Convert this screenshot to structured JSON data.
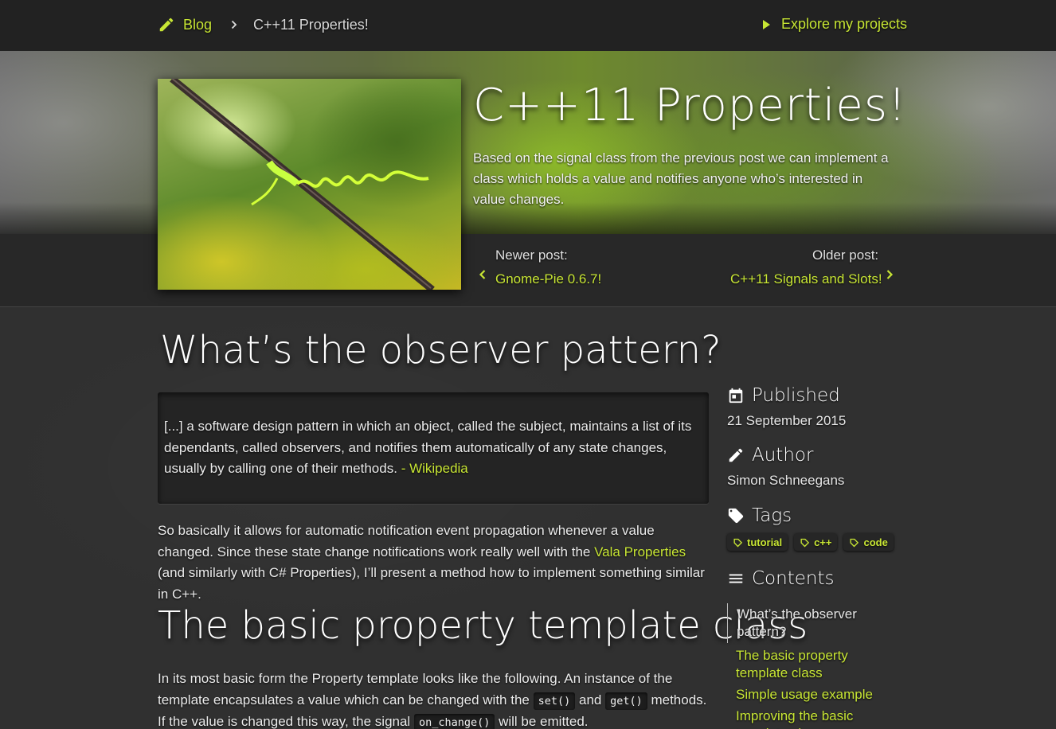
{
  "nav": {
    "blog_label": "Blog",
    "current_crumb": "C++11 Properties!",
    "projects_label": "Explore my projects"
  },
  "hero": {
    "title": "C++11 Properties!",
    "excerpt": "Based on the signal class from the previous post we can implement a class which holds a value and notifies anyone who’s interested in value changes.",
    "newer_label": "Newer post:",
    "newer_link": "Gnome-Pie 0.6.7!",
    "older_label": "Older post:",
    "older_link": "C++11 Signals and Slots!"
  },
  "article": {
    "heading1": "What’s the observer pattern?",
    "quote_text": "[...] a software design pattern in which an object, called the subject, maintains a list of its dependants, called observers, and notifies them automatically of any state changes, usually by calling one of their methods.",
    "quote_source": "- Wikipedia",
    "para1_a": "So basically it allows for automatic notification event propagation whenever a value changed. Since these state change notifications work really well with the",
    "para1_link": "Vala Properties",
    "para1_b": "(and similarly with C# Properties), I’ll present a method how to implement something similar in C++.",
    "heading2": "The basic property template class",
    "para2_a": "In its most basic form the Property template looks like the following. An instance of the template encapsulates a value which can be changed with the",
    "code_set": "set()",
    "para2_and": "and",
    "code_get": "get()",
    "para2_b": "methods. If the value is changed this way, the signal",
    "code_on_change": "on_change()",
    "para2_c": "will be emitted."
  },
  "sidebar": {
    "published_label": "Published",
    "published_date": "21 September 2015",
    "author_label": "Author",
    "author_name": "Simon Schneegans",
    "tags_label": "Tags",
    "tags": [
      "tutorial",
      "c++",
      "code"
    ],
    "contents_label": "Contents",
    "toc": [
      "What’s the observer pattern?",
      "The basic property template class",
      "Simple usage example",
      "Improving the basic template class"
    ]
  },
  "colors": {
    "accent": "#c8e634",
    "background": "#303030",
    "topbar": "#222222"
  },
  "icons": {
    "blog": "pencil-icon",
    "breadcrumb_separator": "chevron-right-icon",
    "projects": "play-icon",
    "published": "calendar-icon",
    "author": "pencil-icon",
    "tags": "tag-icon",
    "contents": "menu-icon"
  }
}
